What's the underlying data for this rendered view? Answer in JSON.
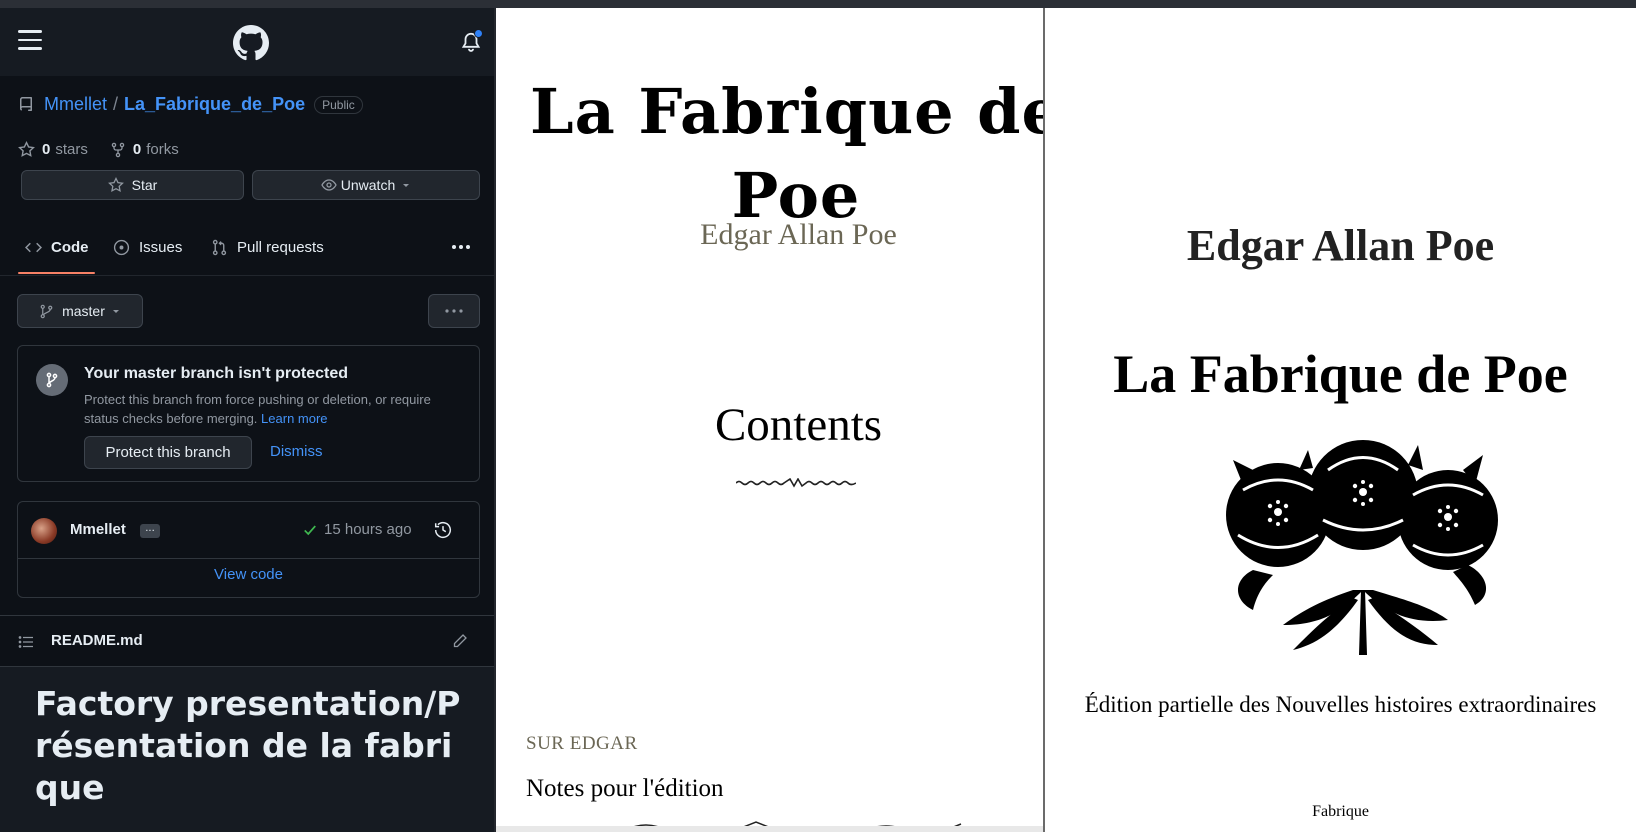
{
  "github": {
    "repo": {
      "owner": "Mmellet",
      "separator": "/",
      "name": "La_Fabrique_de_Poe",
      "visibility": "Public"
    },
    "stats": {
      "stars_count": "0",
      "stars_label": "stars",
      "forks_count": "0",
      "forks_label": "forks"
    },
    "actions": {
      "star_label": "Star",
      "watch_label": "Unwatch"
    },
    "tabs": [
      {
        "label": "Code",
        "active": true
      },
      {
        "label": "Issues",
        "active": false
      },
      {
        "label": "Pull requests",
        "active": false
      }
    ],
    "branch": {
      "name": "master"
    },
    "protection": {
      "title": "Your master branch isn't protected",
      "description": "Protect this branch from force pushing or deletion, or require status checks before merging.",
      "learn_more": "Learn more",
      "protect_button": "Protect this branch",
      "dismiss_button": "Dismiss"
    },
    "commit": {
      "author": "Mmellet",
      "ellipsis": "...",
      "time": "15 hours ago",
      "view_code": "View code"
    },
    "readme": {
      "filename": "README.md",
      "heading": "Factory presentation/Présentation de la fabrique"
    },
    "colors": {
      "background": "#0d1117",
      "link": "#4493f8",
      "active_tab": "#f78166",
      "success": "#3fb950"
    }
  },
  "book_left": {
    "title": "La Fabrique de Poe",
    "author": "Edgar Allan Poe",
    "contents_heading": "Contents",
    "section_label": "SUR EDGAR",
    "entry": "Notes pour l'édition"
  },
  "book_right": {
    "author": "Edgar Allan Poe",
    "title": "La Fabrique de Poe",
    "edition": "Édition partielle des Nouvelles histoires extraordinaires",
    "publisher": "Fabrique"
  }
}
